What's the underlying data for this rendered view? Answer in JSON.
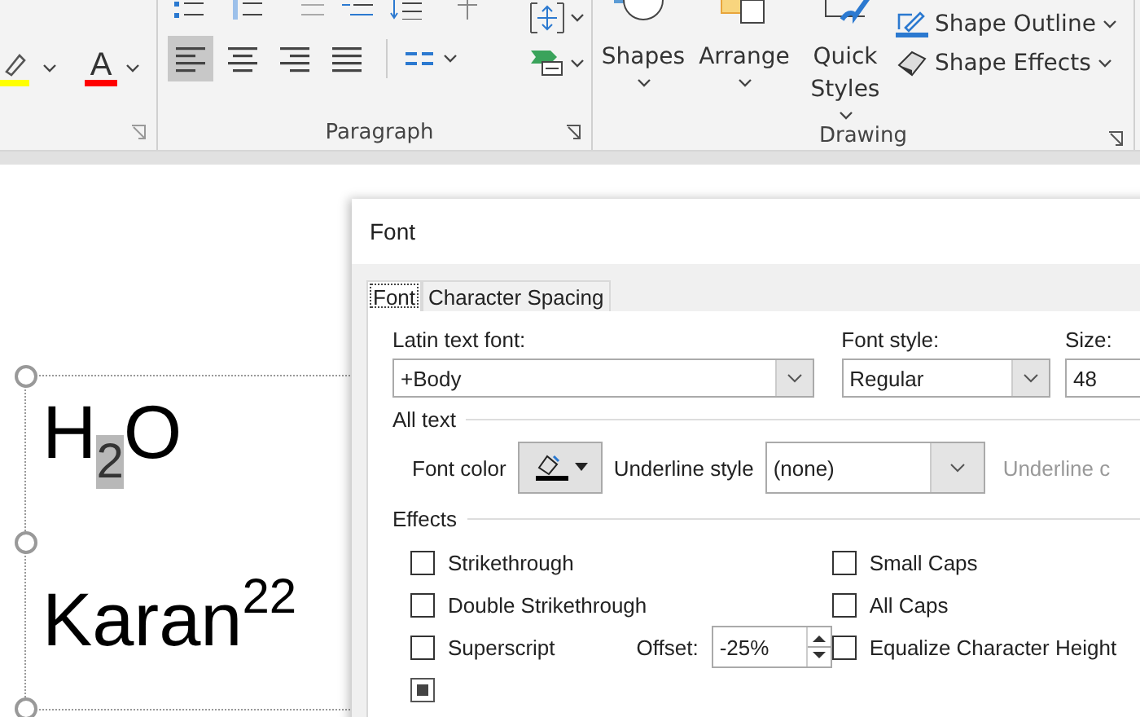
{
  "ribbon": {
    "font_group": {
      "tools": [
        {
          "kind": "highlight",
          "color": "#ffff00"
        },
        {
          "kind": "font-color",
          "color": "#ff0000",
          "label": "A"
        }
      ]
    },
    "paragraph_group": {
      "label": "Paragraph",
      "alignments": [
        {
          "kind": "left",
          "selected": true
        },
        {
          "kind": "center",
          "selected": false
        },
        {
          "kind": "right",
          "selected": false
        },
        {
          "kind": "justify",
          "selected": false
        }
      ]
    },
    "drawing_group": {
      "label": "Drawing",
      "big_buttons": [
        {
          "kind": "shapes",
          "label": "Shapes"
        },
        {
          "kind": "arrange",
          "label": "Arrange"
        },
        {
          "kind": "styles",
          "label": "Quick Styles"
        }
      ],
      "small_buttons": [
        {
          "kind": "outline",
          "label": "Shape Outline"
        },
        {
          "kind": "effects",
          "label": "Shape Effects"
        }
      ]
    }
  },
  "document": {
    "lines": [
      [
        {
          "text": "H",
          "kind": "normal",
          "highlighted": false
        },
        {
          "text": "2",
          "kind": "subscript",
          "highlighted": true
        },
        {
          "text": "O",
          "kind": "normal",
          "highlighted": false
        }
      ],
      [
        {
          "text": "Karan",
          "kind": "normal",
          "highlighted": false
        },
        {
          "text": "22",
          "kind": "superscript",
          "highlighted": false
        }
      ]
    ]
  },
  "dialog": {
    "title": "Font",
    "tabs": [
      {
        "label": "Font",
        "selected": true
      },
      {
        "label": "Character Spacing",
        "selected": false
      }
    ],
    "latin_font": {
      "label": "Latin text font:",
      "value": "+Body"
    },
    "font_style": {
      "label": "Font style:",
      "value": "Regular"
    },
    "size": {
      "label": "Size:",
      "value": "48"
    },
    "all_text": {
      "heading": "All text",
      "font_color_label": "Font color",
      "underline_style_label": "Underline style",
      "underline_style_value": "(none)",
      "underline_color_label": "Underline c",
      "underline_color_disabled": true
    },
    "effects": {
      "heading": "Effects",
      "left": [
        {
          "label": "Strikethrough",
          "checked": false
        },
        {
          "label": "Double Strikethrough",
          "checked": false
        },
        {
          "label": "Superscript",
          "checked": false
        },
        {
          "checked": true
        }
      ],
      "right": [
        {
          "label": "Small Caps",
          "checked": false
        },
        {
          "label": "All Caps",
          "checked": false
        },
        {
          "label": "Equalize Character Height",
          "checked": false
        }
      ],
      "offset": {
        "label": "Offset:",
        "value": "-25%"
      }
    }
  }
}
